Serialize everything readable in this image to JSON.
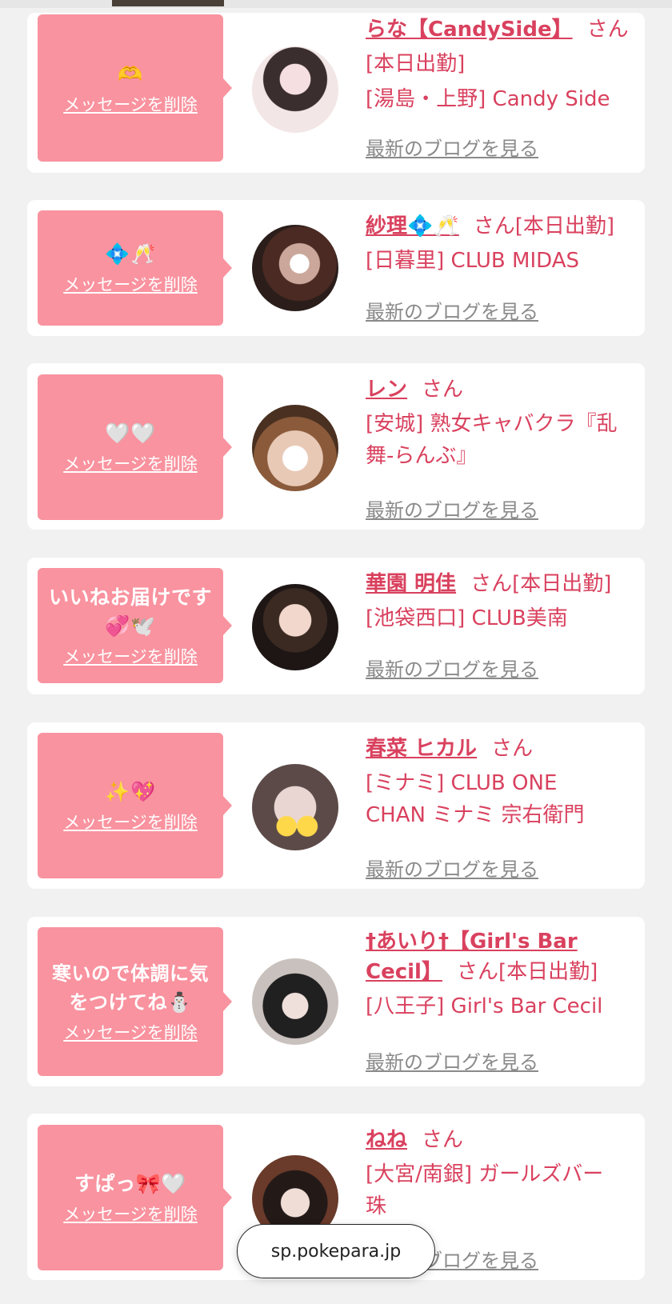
{
  "delete_label": "メッセージを削除",
  "blog_label": "最新のブログを見る",
  "san_label": "さん",
  "attend_label": "[本日出勤]",
  "browser": {
    "url": "sp.pokepara.jp"
  },
  "cards": [
    {
      "message": "🫶",
      "name": "らな【CandySide】",
      "attendance": "[本日出勤]",
      "shop_lines": [
        "[湯島・上野] Candy Side"
      ]
    },
    {
      "message": "💠🥂",
      "name": "紗理💠🥂",
      "attendance": "[本日出勤]",
      "shop_lines": [
        "[日暮里] CLUB MIDAS"
      ]
    },
    {
      "message": "🤍🤍",
      "name": "レン",
      "attendance": "",
      "shop_lines": [
        "[安城] 熟女キャバクラ『乱",
        "舞-らんぶ』"
      ]
    },
    {
      "message": "いいねお届けです\n💞🕊️",
      "name": "華園 明佳",
      "attendance": "[本日出勤]",
      "shop_lines": [
        "[池袋西口] CLUB美南"
      ]
    },
    {
      "message": "✨💖",
      "name": "春菜 ヒカル",
      "attendance": "",
      "shop_lines": [
        "[ミナミ] CLUB ONE",
        "CHAN ミナミ 宗右衛門"
      ]
    },
    {
      "message": "寒いので体調に気\nをつけてね⛄",
      "name": "†あいり†【Girl's Bar Cecil】",
      "attendance": "[本日出勤]",
      "shop_lines": [
        "[八王子] Girl's Bar Cecil"
      ]
    },
    {
      "message": "すぱっ🎀🤍",
      "name": "ねね",
      "attendance": "",
      "shop_lines": [
        "[大宮/南銀] ガールズバー",
        "珠"
      ]
    }
  ]
}
